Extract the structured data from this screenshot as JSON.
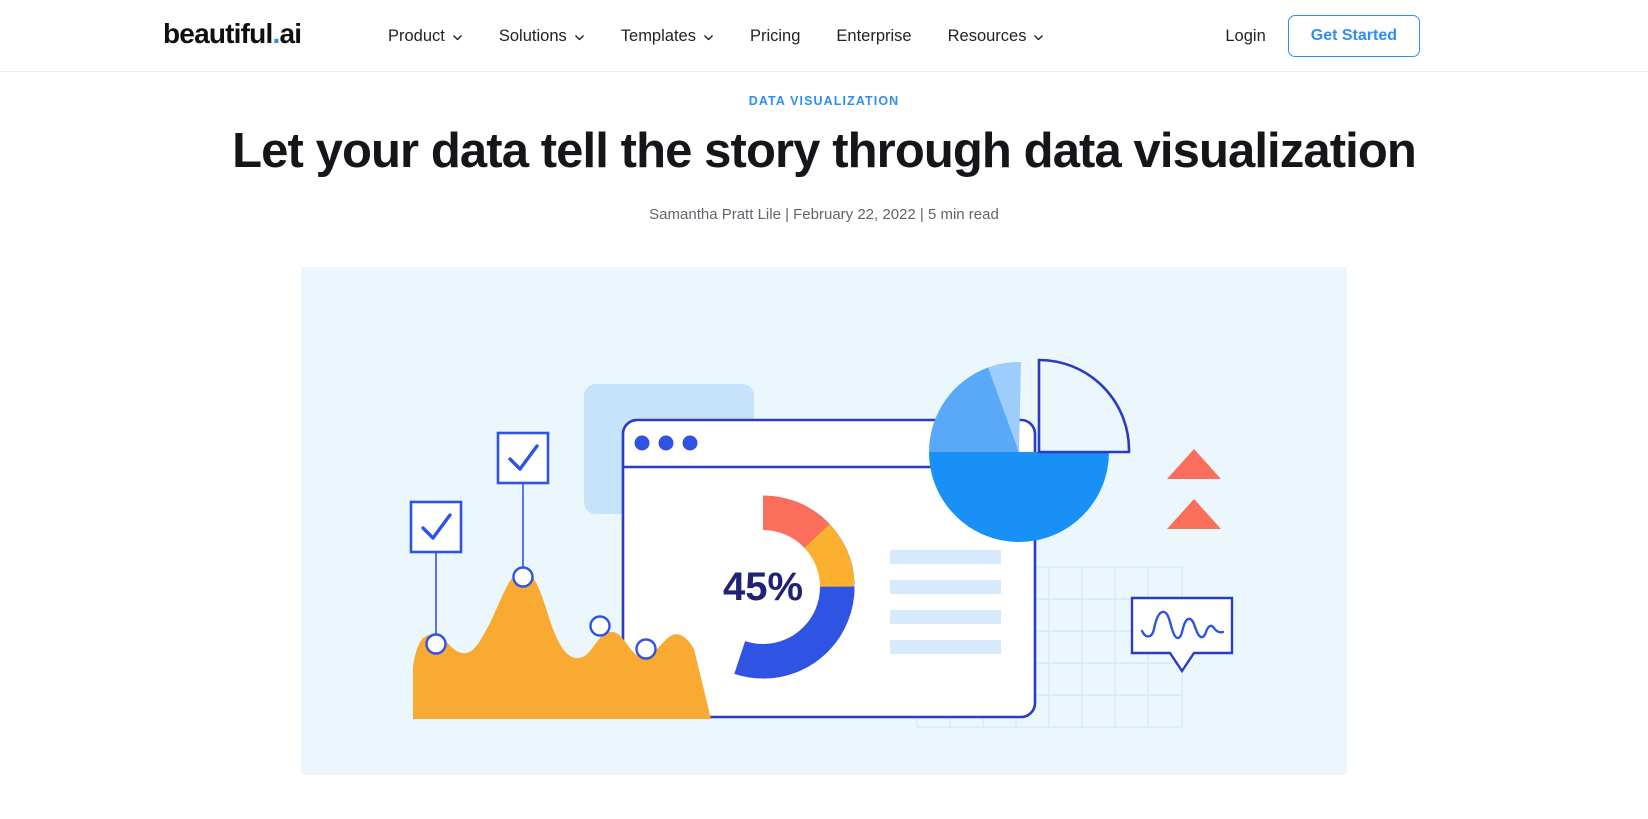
{
  "header": {
    "logo_text": "beautiful",
    "logo_dot": ".",
    "logo_suffix": "ai",
    "nav": [
      {
        "label": "Product",
        "has_dropdown": true
      },
      {
        "label": "Solutions",
        "has_dropdown": true
      },
      {
        "label": "Templates",
        "has_dropdown": true
      },
      {
        "label": "Pricing",
        "has_dropdown": false
      },
      {
        "label": "Enterprise",
        "has_dropdown": false
      },
      {
        "label": "Resources",
        "has_dropdown": true
      }
    ],
    "login_label": "Login",
    "cta_label": "Get Started",
    "accent_color": "#2f8ef4"
  },
  "article": {
    "category": "DATA VISUALIZATION",
    "title": "Let your data tell the story through data visualization",
    "author": "Samantha Pratt Lile",
    "separator": "|",
    "date": "February 22, 2022",
    "read_time": "5 min read",
    "byline": "Samantha Pratt Lile | February 22, 2022 | 5 min read"
  },
  "hero": {
    "alt": "data visualization illustration",
    "background_color": "#ebf7fd",
    "donut_center_label": "45%",
    "colors": {
      "navy": "#1f2275",
      "coral": "#fb6e5b",
      "amber": "#fcb030",
      "royal_blue": "#2f53e3",
      "bright_blue": "#1890f5",
      "mid_blue": "#5aa9f8",
      "light_blue": "#9fcdfb",
      "pale_blue": "#c7e2fb",
      "line_blue": "#d7eafd",
      "outline_blue": "#2a3bc4",
      "orange_area": "#f9aa33",
      "grid_blue": "#d5eafc"
    },
    "donut_segments": [
      {
        "name": "navy",
        "color": "#1f2275",
        "percent": 45
      },
      {
        "name": "coral",
        "color": "#fb6e5b",
        "percent": 13
      },
      {
        "name": "amber",
        "color": "#fcb030",
        "percent": 12
      },
      {
        "name": "royal-blue",
        "color": "#2f53e3",
        "percent": 30
      }
    ],
    "pie_segments": [
      {
        "name": "bright-blue-half",
        "color": "#1890f5",
        "percent": 50
      },
      {
        "name": "mid-blue",
        "color": "#5aa9f8",
        "percent": 17
      },
      {
        "name": "light-blue",
        "color": "#9fcdfb",
        "percent": 8
      },
      {
        "name": "outlined-quarter",
        "color": "#ffffff",
        "percent": 25
      }
    ],
    "checkbox_count": 2,
    "data_point_count": 4,
    "content_line_count": 4,
    "triangle_count": 2
  }
}
